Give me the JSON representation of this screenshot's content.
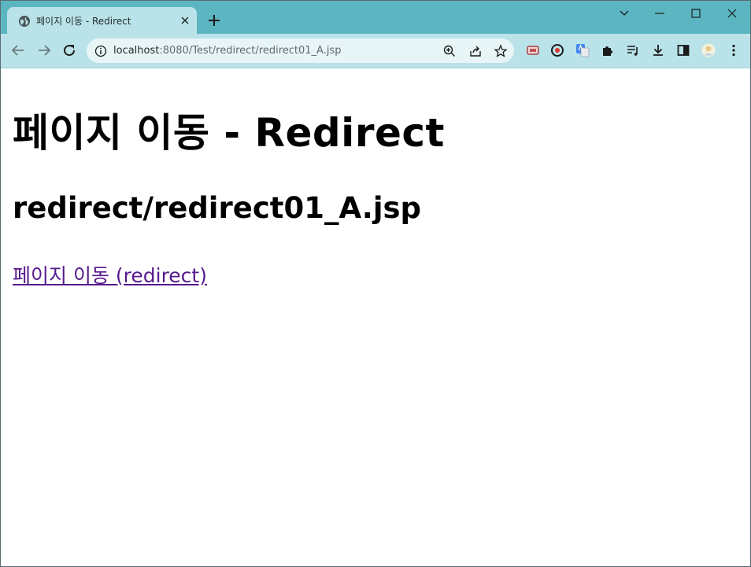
{
  "browser": {
    "tab": {
      "title": "페이지 이동 - Redirect",
      "favicon": "globe-icon"
    },
    "address": {
      "host": "localhost",
      "rest": ":8080/Test/redirect/redirect01_A.jsp"
    },
    "colors": {
      "frame": "#5bb6c2",
      "toolbar": "#b9e3e8",
      "omnibox": "#e8f5f7"
    }
  },
  "page": {
    "heading": "페이지 이동 - Redirect",
    "subheading": "redirect/redirect01_A.jsp",
    "link_text": "페이지 이동 (redirect)",
    "link_color": "#551a8b"
  }
}
